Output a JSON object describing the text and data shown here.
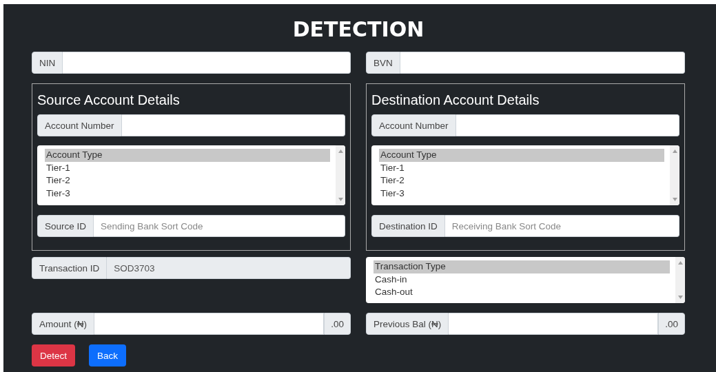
{
  "title": "DETECTION",
  "id_fields": [
    {
      "label": "NIN"
    },
    {
      "label": "BVN"
    }
  ],
  "panels": [
    {
      "heading": "Source Account Details",
      "account_number": {
        "label": "Account Number"
      },
      "account_type": {
        "options": [
          {
            "label": "Account Type",
            "selected": true
          },
          {
            "label": "Tier-1",
            "selected": false
          },
          {
            "label": "Tier-2",
            "selected": false
          },
          {
            "label": "Tier-3",
            "selected": false
          }
        ]
      },
      "id_field": {
        "label": "Source ID",
        "placeholder": "Sending Bank Sort Code"
      }
    },
    {
      "heading": "Destination Account Details",
      "account_number": {
        "label": "Account Number"
      },
      "account_type": {
        "options": [
          {
            "label": "Account Type",
            "selected": true
          },
          {
            "label": "Tier-1",
            "selected": false
          },
          {
            "label": "Tier-2",
            "selected": false
          },
          {
            "label": "Tier-3",
            "selected": false
          }
        ]
      },
      "id_field": {
        "label": "Destination ID",
        "placeholder": "Receiving Bank Sort Code"
      }
    }
  ],
  "transaction_id": {
    "label": "Transaction ID",
    "value": "SOD3703",
    "disabled": true
  },
  "transaction_type": {
    "options": [
      {
        "label": "Transaction Type",
        "selected": true
      },
      {
        "label": "Cash-in",
        "selected": false
      },
      {
        "label": "Cash-out",
        "selected": false
      }
    ]
  },
  "amount_fields": [
    {
      "label": "Amount (₦)",
      "suffix": ".00"
    },
    {
      "label": "Previous Bal (₦)",
      "suffix": ".00"
    }
  ],
  "buttons": [
    {
      "label": "Detect",
      "kind": "danger"
    },
    {
      "label": "Back",
      "kind": "primary"
    }
  ]
}
